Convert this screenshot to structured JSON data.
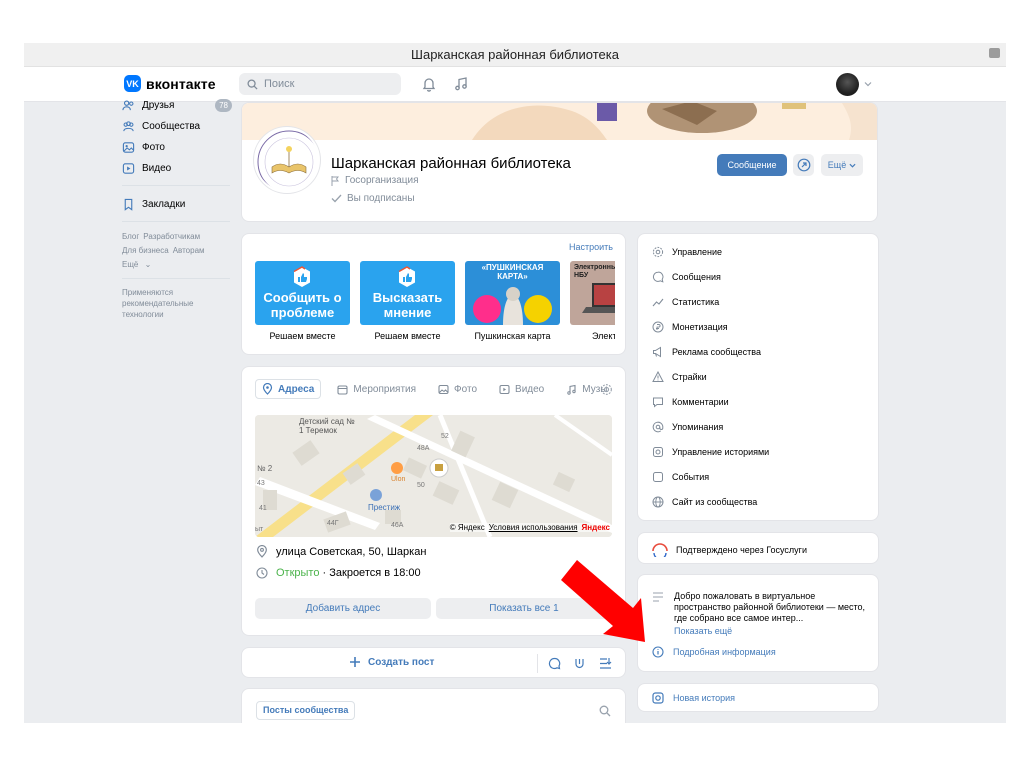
{
  "slide": {
    "title": "Шарканская районная библиотека"
  },
  "topbar": {
    "logo_text": "вконтакте",
    "logo_mark": "VK",
    "search_placeholder": "Поиск"
  },
  "leftnav": {
    "items": [
      {
        "label": "Друзья",
        "badge": "78",
        "icon": "friends-icon"
      },
      {
        "label": "Сообщества",
        "icon": "communities-icon"
      },
      {
        "label": "Фото",
        "icon": "photo-icon"
      },
      {
        "label": "Видео",
        "icon": "video-icon"
      },
      {
        "label": "Закладки",
        "icon": "bookmark-icon"
      }
    ],
    "links": [
      "Блог",
      "Разработчикам",
      "Для бизнеса",
      "Авторам",
      "Ещё"
    ],
    "note": "Применяются рекомендательные технологии"
  },
  "community": {
    "name": "Шарканская районная библиотека",
    "type": "Госорганизация",
    "subscribed": "Вы подписаны",
    "message_button": "Сообщение",
    "more_button": "Ещё",
    "logo_text_top": "МБУК",
    "logo_text_bottom": "«ЦБС Шарканского района»"
  },
  "widget": {
    "settings_label": "Настроить",
    "tiles": [
      {
        "title": "Сообщить о проблеме",
        "caption": "Решаем вместе"
      },
      {
        "title": "Высказать мнение",
        "caption": "Решаем вместе"
      },
      {
        "title": "«ПУШКИНСКАЯ КАРТА»",
        "caption": "Пушкинская карта"
      },
      {
        "title": "Электронный НБУ",
        "caption": "Электронны"
      }
    ]
  },
  "address_block": {
    "tabs": [
      {
        "label": "Адреса",
        "active": true
      },
      {
        "label": "Мероприятия"
      },
      {
        "label": "Фото"
      },
      {
        "label": "Видео"
      },
      {
        "label": "Музы"
      }
    ],
    "map": {
      "labels": [
        "Детский сад № 1 Теремок",
        "Престиж",
        "Ulon",
        "№ 2",
        "52",
        "48А",
        "50",
        "44Г",
        "46А",
        "41",
        "43",
        "ыт"
      ],
      "copyright": "© Яндекс",
      "terms": "Условия использования",
      "brand": "Яндекс"
    },
    "address": "улица Советская, 50, Шаркан",
    "status_open": "Открыто",
    "status_close": "· Закроется в 18:00",
    "add_address": "Добавить адрес",
    "show_all": "Показать все 1"
  },
  "create_post": {
    "label": "Создать пост"
  },
  "posts": {
    "tab": "Посты сообщества"
  },
  "manage_menu": {
    "items": [
      {
        "label": "Управление",
        "icon": "gear-icon"
      },
      {
        "label": "Сообщения",
        "icon": "message-icon"
      },
      {
        "label": "Статистика",
        "icon": "stats-icon"
      },
      {
        "label": "Монетизация",
        "icon": "ruble-icon"
      },
      {
        "label": "Реклама сообщества",
        "icon": "megaphone-icon"
      },
      {
        "label": "Страйки",
        "icon": "warning-icon"
      },
      {
        "label": "Комментарии",
        "icon": "comment-icon"
      },
      {
        "label": "Упоминания",
        "icon": "at-icon"
      },
      {
        "label": "Управление историями",
        "icon": "story-icon"
      },
      {
        "label": "События",
        "icon": "event-icon"
      },
      {
        "label": "Сайт из сообщества",
        "icon": "globe-icon"
      }
    ]
  },
  "gosuslugi": {
    "label": "Подтверждено через Госуслуги"
  },
  "description": {
    "text": "Добро пожаловать в виртуальное пространство районной библиотеки — место, где собрано все самое интер...",
    "more": "Показать ещё",
    "info": "Подробная информация"
  },
  "story": {
    "label": "Новая история"
  },
  "colors": {
    "accent": "#447bba",
    "vk_blue": "#0077ff",
    "open_green": "#4bb34b",
    "arrow_red": "#ff0000"
  }
}
